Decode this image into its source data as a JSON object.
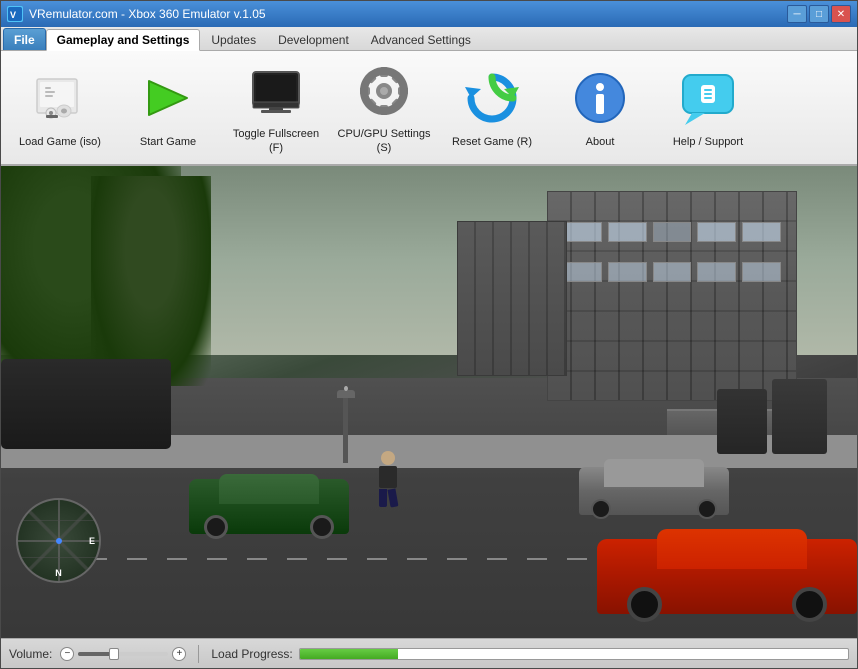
{
  "window": {
    "title": "VRemulator.com - Xbox 360 Emulator v.1.05",
    "icon_label": "VR"
  },
  "titlebar": {
    "minimize": "─",
    "maximize": "□",
    "close": "✕"
  },
  "menu": {
    "tabs": [
      {
        "id": "file",
        "label": "File",
        "active": false,
        "is_file": true
      },
      {
        "id": "gameplay",
        "label": "Gameplay and Settings",
        "active": true,
        "is_file": false
      },
      {
        "id": "updates",
        "label": "Updates",
        "active": false,
        "is_file": false
      },
      {
        "id": "development",
        "label": "Development",
        "active": false,
        "is_file": false
      },
      {
        "id": "advanced",
        "label": "Advanced Settings",
        "active": false,
        "is_file": false
      }
    ]
  },
  "toolbar": {
    "buttons": [
      {
        "id": "load-game",
        "label": "Load Game (iso)"
      },
      {
        "id": "start-game",
        "label": "Start Game"
      },
      {
        "id": "toggle-fullscreen",
        "label": "Toggle Fullscreen (F)"
      },
      {
        "id": "cpu-gpu-settings",
        "label": "CPU/GPU Settings (S)"
      },
      {
        "id": "reset-game",
        "label": "Reset Game (R)"
      },
      {
        "id": "about",
        "label": "About"
      },
      {
        "id": "help-support",
        "label": "Help / Support"
      }
    ]
  },
  "statusbar": {
    "volume_label": "Volume:",
    "load_progress_label": "Load Progress:",
    "volume_level": 0.4,
    "progress_level": 0.18
  }
}
